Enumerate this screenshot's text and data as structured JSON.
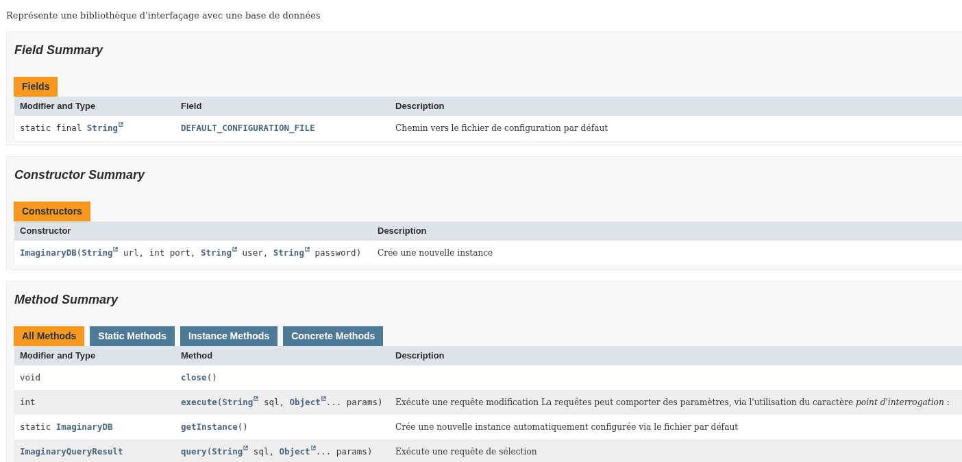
{
  "intro": "Représente une bibliothèque d'interfaçage avec une base de données",
  "sections": [
    {
      "title": "Field Summary",
      "tabs": [
        {
          "label": "Fields",
          "selected": true
        }
      ],
      "columns": [
        "Modifier and Type",
        "Field",
        "Description"
      ],
      "rows": [
        {
          "cells": [
            {
              "kind": "code",
              "parts": [
                {
                  "kind": "plain",
                  "text": "static final "
                },
                {
                  "kind": "extlink",
                  "text": "String"
                }
              ]
            },
            {
              "kind": "code",
              "parts": [
                {
                  "kind": "link",
                  "text": "DEFAULT_CONFIGURATION_FILE"
                }
              ]
            },
            {
              "kind": "text",
              "text": "Chemin vers le fichier de configuration par défaut"
            }
          ]
        }
      ]
    },
    {
      "title": "Constructor Summary",
      "tabs": [
        {
          "label": "Constructors",
          "selected": true
        }
      ],
      "columns": [
        "Constructor",
        "Description"
      ],
      "rows": [
        {
          "cells": [
            {
              "kind": "code",
              "parts": [
                {
                  "kind": "link",
                  "text": "ImaginaryDB"
                },
                {
                  "kind": "plain",
                  "text": "("
                },
                {
                  "kind": "extlink",
                  "text": "String"
                },
                {
                  "kind": "plain",
                  "text": " url, int port, "
                },
                {
                  "kind": "extlink",
                  "text": "String"
                },
                {
                  "kind": "plain",
                  "text": " user, "
                },
                {
                  "kind": "extlink",
                  "text": "String"
                },
                {
                  "kind": "plain",
                  "text": " password)"
                }
              ]
            },
            {
              "kind": "text",
              "text": "Crée une nouvelle instance"
            }
          ]
        }
      ]
    },
    {
      "title": "Method Summary",
      "tabs": [
        {
          "label": "All Methods",
          "selected": true
        },
        {
          "label": "Static Methods",
          "selected": false
        },
        {
          "label": "Instance Methods",
          "selected": false
        },
        {
          "label": "Concrete Methods",
          "selected": false
        }
      ],
      "columns": [
        "Modifier and Type",
        "Method",
        "Description"
      ],
      "rows": [
        {
          "cells": [
            {
              "kind": "code",
              "parts": [
                {
                  "kind": "plain",
                  "text": "void"
                }
              ]
            },
            {
              "kind": "code",
              "parts": [
                {
                  "kind": "link",
                  "text": "close"
                },
                {
                  "kind": "plain",
                  "text": "()"
                }
              ]
            }
          ]
        },
        {
          "cells": [
            {
              "kind": "code",
              "parts": [
                {
                  "kind": "plain",
                  "text": "int"
                }
              ]
            },
            {
              "kind": "code",
              "parts": [
                {
                  "kind": "link",
                  "text": "execute"
                },
                {
                  "kind": "plain",
                  "text": "("
                },
                {
                  "kind": "extlink",
                  "text": "String"
                },
                {
                  "kind": "plain",
                  "text": " sql, "
                },
                {
                  "kind": "extlink",
                  "text": "Object"
                },
                {
                  "kind": "plain",
                  "text": "... params)"
                }
              ]
            },
            {
              "kind": "text",
              "text": "Exécute une requête modification La requêtes peut comporter des paramètres, via l'utilisation du caractère *point d'interrogation* :"
            }
          ]
        },
        {
          "cells": [
            {
              "kind": "code",
              "parts": [
                {
                  "kind": "plain",
                  "text": "static "
                },
                {
                  "kind": "link",
                  "text": "ImaginaryDB"
                }
              ]
            },
            {
              "kind": "code",
              "parts": [
                {
                  "kind": "link",
                  "text": "getInstance"
                },
                {
                  "kind": "plain",
                  "text": "()"
                }
              ]
            },
            {
              "kind": "text",
              "text": "Crée une nouvelle instance automatiquement configurée via le fichier par défaut"
            }
          ]
        },
        {
          "cells": [
            {
              "kind": "code",
              "parts": [
                {
                  "kind": "link",
                  "text": "ImaginaryQueryResult"
                }
              ]
            },
            {
              "kind": "code",
              "parts": [
                {
                  "kind": "link",
                  "text": "query"
                },
                {
                  "kind": "plain",
                  "text": "("
                },
                {
                  "kind": "extlink",
                  "text": "String"
                },
                {
                  "kind": "plain",
                  "text": " sql, "
                },
                {
                  "kind": "extlink",
                  "text": "Object"
                },
                {
                  "kind": "plain",
                  "text": "... params)"
                }
              ]
            },
            {
              "kind": "text",
              "text": "Exécute une requête de sélection"
            }
          ]
        }
      ]
    }
  ]
}
